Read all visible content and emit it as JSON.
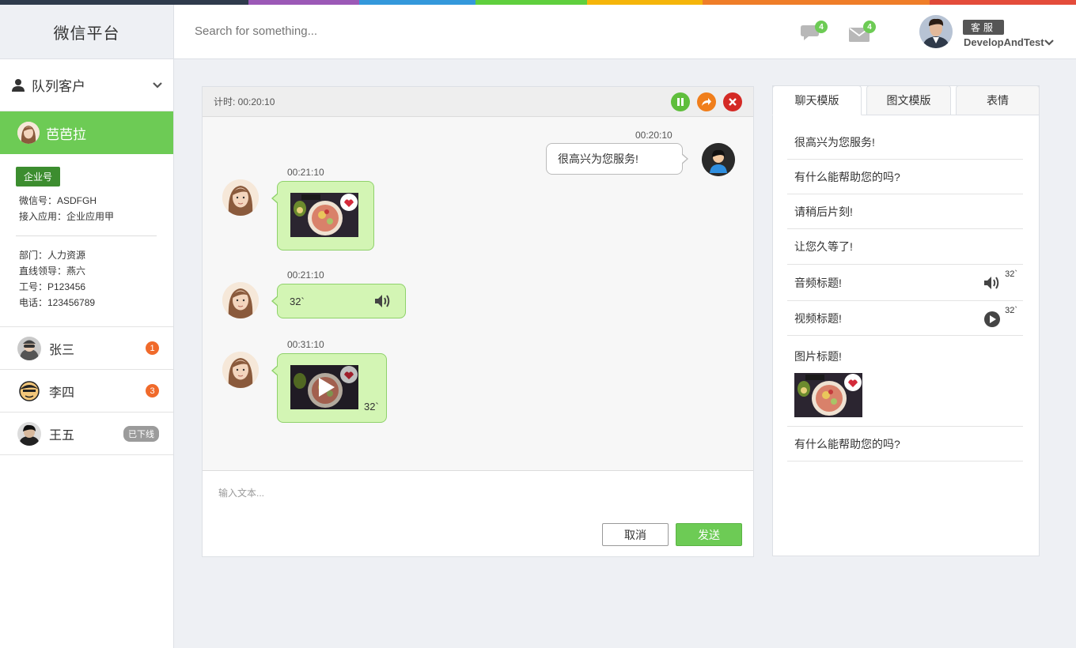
{
  "colors": {
    "strip": [
      "#2f3b4c",
      "#9b59b6",
      "#3498db",
      "#5fcf3d",
      "#f5b50a",
      "#ef7d28",
      "#e44c3b"
    ],
    "accent_green": "#6dcb55",
    "badge_orange": "#f06a2b"
  },
  "brand": "微信平台",
  "search": {
    "placeholder": "Search for something..."
  },
  "header": {
    "chat_badge": "4",
    "mail_badge": "4",
    "role": "客服",
    "user_name": "DevelopAndTest"
  },
  "sidebar": {
    "queue_title": "队列客户",
    "active_customer": "芭芭拉",
    "account_tag": "企业号",
    "info": [
      "微信号：ASDFGH",
      "接入应用：企业应用甲"
    ],
    "info2": [
      "部门：人力资源",
      "直线领导：燕六",
      "工号：P123456",
      "电话：123456789"
    ],
    "customers": [
      {
        "name": "张三",
        "badge": "1"
      },
      {
        "name": "李四",
        "badge": "3"
      },
      {
        "name": "王五",
        "status": "已下线"
      }
    ]
  },
  "chat": {
    "timer": "计时: 00:20:10",
    "messages": [
      {
        "time": "00:20:10",
        "text": "很高兴为您服务!"
      },
      {
        "time": "00:21:10"
      },
      {
        "time": "00:21:10",
        "duration": "32`"
      },
      {
        "time": "00:31:10",
        "duration": "32`"
      }
    ],
    "input_placeholder": "输入文本...",
    "cancel": "取消",
    "send": "发送"
  },
  "templates": {
    "tabs": [
      "聊天模版",
      "图文模版",
      "表情"
    ],
    "items": [
      "很高兴为您服务!",
      "有什么能帮助您的吗?",
      "请稍后片刻!",
      "让您久等了!",
      "音频标题!",
      "视频标题!",
      "图片标题!",
      "有什么能帮助您的吗?"
    ],
    "audio_duration": "32`",
    "video_duration": "32`"
  }
}
